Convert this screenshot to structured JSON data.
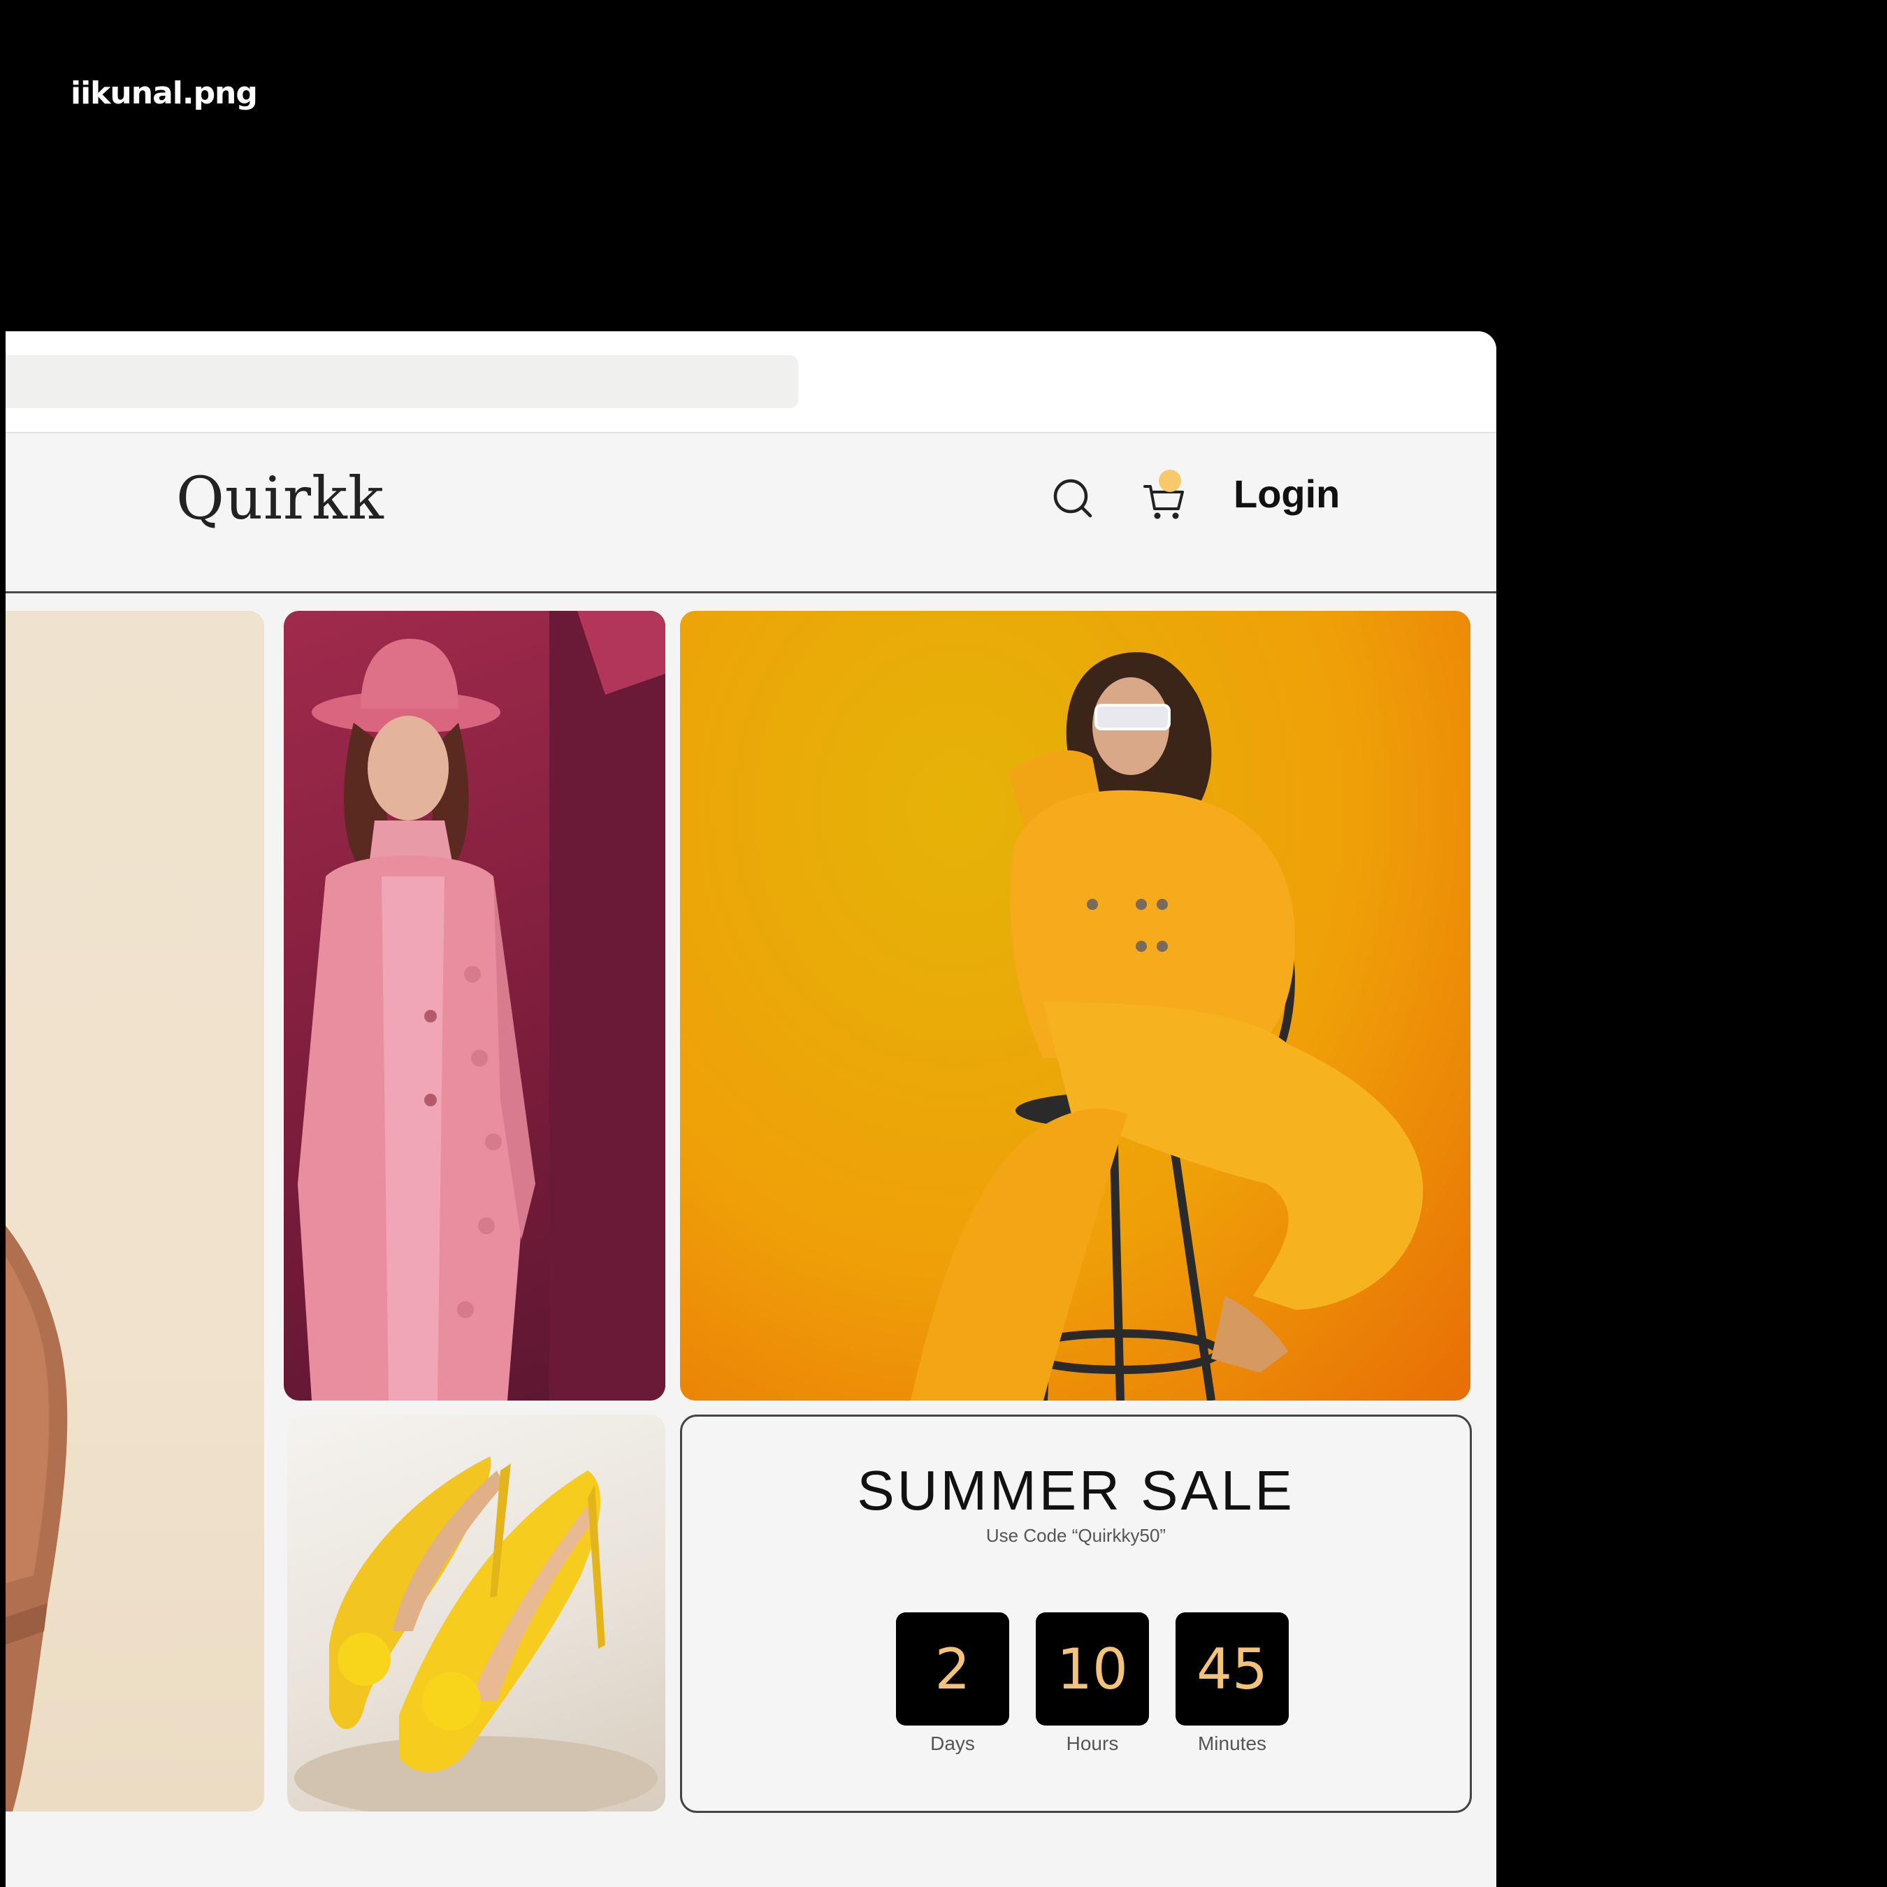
{
  "watermark": "iikunal.png",
  "header": {
    "logo": "Quirkk",
    "login_label": "Login",
    "search_icon": "search-icon",
    "cart_icon": "cart-icon"
  },
  "colors": {
    "accent": "#f8c96a",
    "countdown_text": "#f4c27a",
    "page_bg": "#f4f4f4"
  },
  "sale": {
    "title": "SUMMER SALE",
    "subtitle": "Use Code “Quirkky50”",
    "countdown": [
      {
        "value": "2",
        "label": "Days"
      },
      {
        "value": "10",
        "label": "Hours"
      },
      {
        "value": "45",
        "label": "Minutes"
      }
    ]
  }
}
